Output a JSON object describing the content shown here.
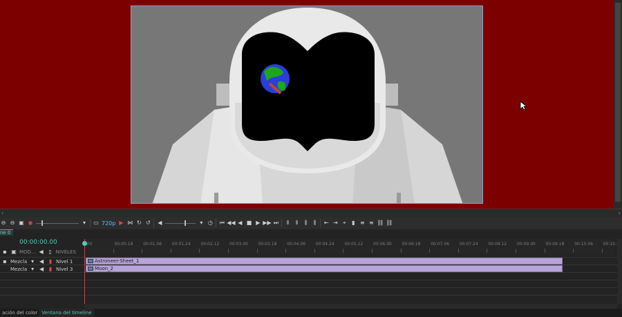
{
  "preview": {
    "background": "#7d0000",
    "canvas_background": "#777777",
    "earth_colors": [
      "#2a3fd6",
      "#1fa51f",
      "#b44a3a"
    ]
  },
  "toolbar": {
    "resolution": "720p",
    "icons": [
      "zoom-out-icon",
      "zoom-fit-icon",
      "safe-area-icon",
      "record-icon",
      "zoom-slider",
      "dropdown-icon",
      "monitor-icon",
      "resolution-dropdown",
      "play-triangle-icon",
      "snap-icon",
      "loop-icon",
      "undo-icon",
      "volume-icon",
      "volume-slider",
      "dropdown-icon",
      "timecode-icon",
      "first-frame-icon",
      "prev-frame-icon",
      "rewind-icon",
      "stop-icon",
      "play-icon",
      "next-frame-icon",
      "last-frame-icon",
      "mark-in-icon",
      "mark-out-icon",
      "split-icon",
      "trim-icon",
      "go-in-icon",
      "go-out-icon",
      "markers-icon",
      "clip-icon",
      "align-left-icon",
      "align-center-icon",
      "link-icon",
      "unlink-icon"
    ]
  },
  "timeline": {
    "tab_label": "ne 0",
    "current_time": "00:00:00.00",
    "header": {
      "mode_label": "MOD...",
      "levels_label": "NIVELES"
    },
    "ruler_ticks": [
      ".00",
      "00:00.18",
      "00:01.06",
      "00:01.24",
      "00:02.12",
      "00:03.00",
      "00:03.18",
      "00:04.06",
      "00:04.24",
      "00:05.12",
      "00:06.00",
      "00:06.18",
      "00:07.06",
      "00:07.24",
      "00:08.12",
      "00:09.00",
      "00:09.18",
      "00:10.06",
      "00:10.24"
    ],
    "tracks": [
      {
        "blend": "Mezcla",
        "level": "Nivel 1",
        "clip": "Astroneer-Sheet_1"
      },
      {
        "blend": "Mezcla",
        "level": "Nivel 3",
        "clip": "Moon_2"
      }
    ]
  },
  "bottom_tabs": [
    {
      "label": "ación del color",
      "active": false
    },
    {
      "label": "Ventana del timeline",
      "active": true
    }
  ]
}
